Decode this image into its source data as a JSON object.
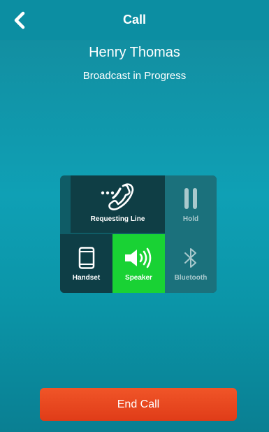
{
  "navbar": {
    "title": "Call",
    "back_icon": "chevron-left-icon"
  },
  "call": {
    "caller_name": "Henry Thomas",
    "status": "Broadcast in Progress"
  },
  "controls": {
    "requesting_line": {
      "label": "Requesting Line",
      "icon": "phone-requesting-icon",
      "active": false
    },
    "hold": {
      "label": "Hold",
      "icon": "pause-icon",
      "enabled": false
    },
    "handset": {
      "label": "Handset",
      "icon": "smartphone-icon",
      "selected": false
    },
    "speaker": {
      "label": "Speaker",
      "icon": "speaker-icon",
      "selected": true
    },
    "bluetooth": {
      "label": "Bluetooth",
      "icon": "bluetooth-icon",
      "enabled": false
    }
  },
  "end_call": {
    "label": "End Call"
  },
  "colors": {
    "accent_teal": "#0fa0b5",
    "speaker_active": "#19d234",
    "end_call": "#e8461f"
  }
}
